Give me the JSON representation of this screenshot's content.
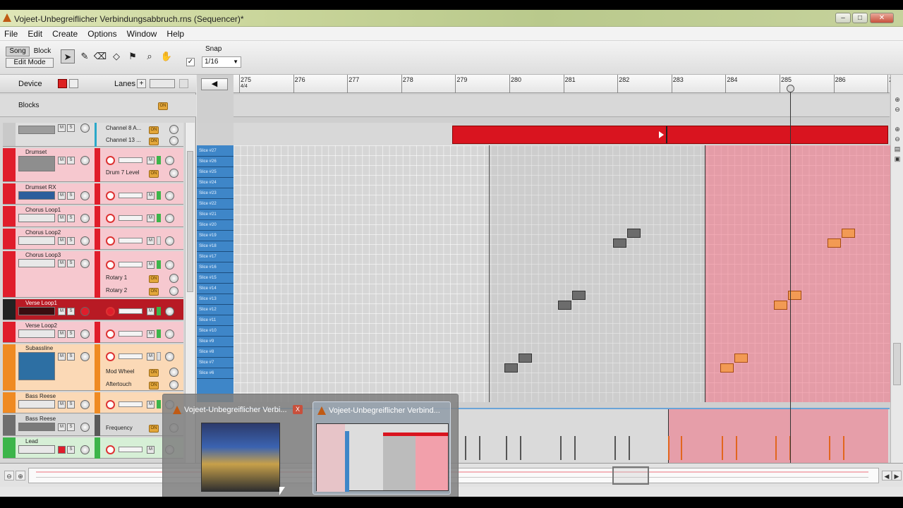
{
  "window": {
    "title": "Vojeet-Unbegreiflicher Verbindungsabbruch.rns (Sequencer)*"
  },
  "menu": [
    "File",
    "Edit",
    "Create",
    "Options",
    "Window",
    "Help"
  ],
  "toolbar": {
    "song_label": "Song",
    "block_label": "Block",
    "edit_mode_label": "Edit Mode",
    "snap_label": "Snap",
    "snap_value": "1/16",
    "snap_checked": "✓"
  },
  "device_header": {
    "device_label": "Device",
    "lanes_label": "Lanes"
  },
  "blocks": {
    "label": "Blocks",
    "on": "ON"
  },
  "tracks": [
    {
      "name": "",
      "lanes": [
        "Channel 8 A...",
        "Channel 13 ..."
      ]
    },
    {
      "name": "Drumset",
      "lanes": [
        "Drum 7 Level"
      ]
    },
    {
      "name": "Drumset RX",
      "lanes": []
    },
    {
      "name": "Chorus Loop1",
      "lanes": []
    },
    {
      "name": "Chorus Loop2",
      "lanes": []
    },
    {
      "name": "Chorus Loop3",
      "lanes": [
        "Rotary 1",
        "Rotary 2"
      ]
    },
    {
      "name": "Verse Loop1",
      "lanes": []
    },
    {
      "name": "Verse Loop2",
      "lanes": []
    },
    {
      "name": "Subassline",
      "lanes": [
        "Mod Wheel",
        "Aftertouch"
      ]
    },
    {
      "name": "Bass Reese",
      "lanes": []
    },
    {
      "name": "Bass Reese",
      "lanes": [
        "Frequency"
      ]
    },
    {
      "name": "Lead",
      "lanes": []
    }
  ],
  "ruler": {
    "bars": [
      "275",
      "276",
      "277",
      "278",
      "279",
      "280",
      "281",
      "282",
      "283",
      "284",
      "285",
      "286",
      "28"
    ],
    "sig": "4/4"
  },
  "slices": [
    "Slice #27",
    "Slice #26",
    "Slice #25",
    "Slice #24",
    "Slice #23",
    "Slice #22",
    "Slice #21",
    "Slice #20",
    "Slice #19",
    "Slice #18",
    "Slice #17",
    "Slice #16",
    "Slice #15",
    "Slice #14",
    "Slice #13",
    "Slice #12",
    "Slice #11",
    "Slice #10",
    "Slice #9",
    "Slice #8",
    "Slice #7",
    "Slice #6"
  ],
  "taskbar_preview": [
    {
      "title": "Vojeet-Unbegreiflicher Verbi...",
      "close": "X"
    },
    {
      "title": "Vojeet-Unbegreiflicher Verbind..."
    }
  ],
  "colors": {
    "clip": "#d9141f",
    "loop": "#f06e82",
    "note_gray": "#6c6c6c",
    "note_orange": "#f29a54",
    "slice_key": "#3e86c8"
  }
}
